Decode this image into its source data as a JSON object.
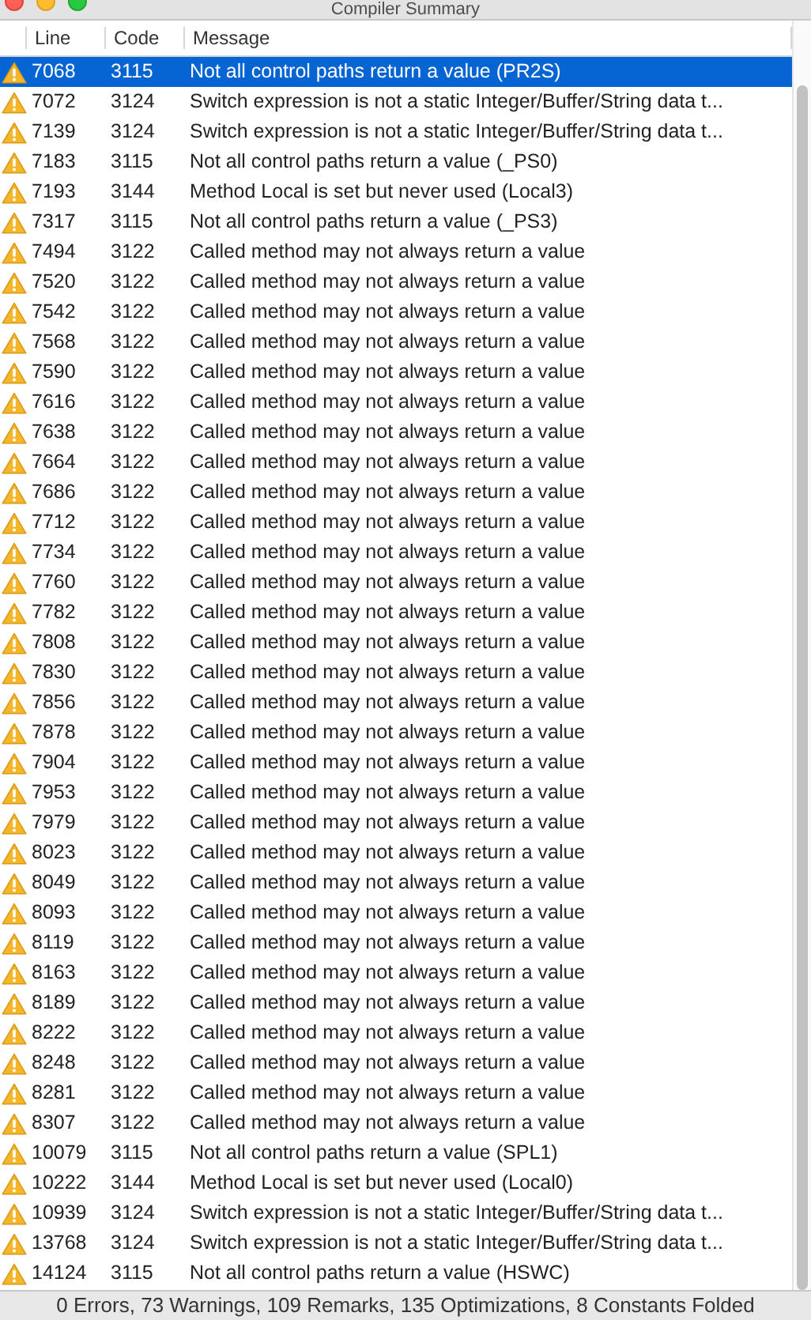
{
  "window": {
    "title": "Compiler Summary"
  },
  "table": {
    "columns": [
      "Line",
      "Code",
      "Message"
    ],
    "rows": [
      {
        "line": "7068",
        "code": "3115",
        "message": "Not all control paths return a value (PR2S)",
        "selected": true
      },
      {
        "line": "7072",
        "code": "3124",
        "message": "Switch expression is not a static Integer/Buffer/String data t...",
        "selected": false
      },
      {
        "line": "7139",
        "code": "3124",
        "message": "Switch expression is not a static Integer/Buffer/String data t...",
        "selected": false
      },
      {
        "line": "7183",
        "code": "3115",
        "message": "Not all control paths return a value (_PS0)",
        "selected": false
      },
      {
        "line": "7193",
        "code": "3144",
        "message": "Method Local is set but never used (Local3)",
        "selected": false
      },
      {
        "line": "7317",
        "code": "3115",
        "message": "Not all control paths return a value (_PS3)",
        "selected": false
      },
      {
        "line": "7494",
        "code": "3122",
        "message": "Called method may not always return a value",
        "selected": false
      },
      {
        "line": "7520",
        "code": "3122",
        "message": "Called method may not always return a value",
        "selected": false
      },
      {
        "line": "7542",
        "code": "3122",
        "message": "Called method may not always return a value",
        "selected": false
      },
      {
        "line": "7568",
        "code": "3122",
        "message": "Called method may not always return a value",
        "selected": false
      },
      {
        "line": "7590",
        "code": "3122",
        "message": "Called method may not always return a value",
        "selected": false
      },
      {
        "line": "7616",
        "code": "3122",
        "message": "Called method may not always return a value",
        "selected": false
      },
      {
        "line": "7638",
        "code": "3122",
        "message": "Called method may not always return a value",
        "selected": false
      },
      {
        "line": "7664",
        "code": "3122",
        "message": "Called method may not always return a value",
        "selected": false
      },
      {
        "line": "7686",
        "code": "3122",
        "message": "Called method may not always return a value",
        "selected": false
      },
      {
        "line": "7712",
        "code": "3122",
        "message": "Called method may not always return a value",
        "selected": false
      },
      {
        "line": "7734",
        "code": "3122",
        "message": "Called method may not always return a value",
        "selected": false
      },
      {
        "line": "7760",
        "code": "3122",
        "message": "Called method may not always return a value",
        "selected": false
      },
      {
        "line": "7782",
        "code": "3122",
        "message": "Called method may not always return a value",
        "selected": false
      },
      {
        "line": "7808",
        "code": "3122",
        "message": "Called method may not always return a value",
        "selected": false
      },
      {
        "line": "7830",
        "code": "3122",
        "message": "Called method may not always return a value",
        "selected": false
      },
      {
        "line": "7856",
        "code": "3122",
        "message": "Called method may not always return a value",
        "selected": false
      },
      {
        "line": "7878",
        "code": "3122",
        "message": "Called method may not always return a value",
        "selected": false
      },
      {
        "line": "7904",
        "code": "3122",
        "message": "Called method may not always return a value",
        "selected": false
      },
      {
        "line": "7953",
        "code": "3122",
        "message": "Called method may not always return a value",
        "selected": false
      },
      {
        "line": "7979",
        "code": "3122",
        "message": "Called method may not always return a value",
        "selected": false
      },
      {
        "line": "8023",
        "code": "3122",
        "message": "Called method may not always return a value",
        "selected": false
      },
      {
        "line": "8049",
        "code": "3122",
        "message": "Called method may not always return a value",
        "selected": false
      },
      {
        "line": "8093",
        "code": "3122",
        "message": "Called method may not always return a value",
        "selected": false
      },
      {
        "line": "8119",
        "code": "3122",
        "message": "Called method may not always return a value",
        "selected": false
      },
      {
        "line": "8163",
        "code": "3122",
        "message": "Called method may not always return a value",
        "selected": false
      },
      {
        "line": "8189",
        "code": "3122",
        "message": "Called method may not always return a value",
        "selected": false
      },
      {
        "line": "8222",
        "code": "3122",
        "message": "Called method may not always return a value",
        "selected": false
      },
      {
        "line": "8248",
        "code": "3122",
        "message": "Called method may not always return a value",
        "selected": false
      },
      {
        "line": "8281",
        "code": "3122",
        "message": "Called method may not always return a value",
        "selected": false
      },
      {
        "line": "8307",
        "code": "3122",
        "message": "Called method may not always return a value",
        "selected": false
      },
      {
        "line": "10079",
        "code": "3115",
        "message": "Not all control paths return a value (SPL1)",
        "selected": false
      },
      {
        "line": "10222",
        "code": "3144",
        "message": "Method Local is set but never used (Local0)",
        "selected": false
      },
      {
        "line": "10939",
        "code": "3124",
        "message": "Switch expression is not a static Integer/Buffer/String data t...",
        "selected": false
      },
      {
        "line": "13768",
        "code": "3124",
        "message": "Switch expression is not a static Integer/Buffer/String data t...",
        "selected": false
      },
      {
        "line": "14124",
        "code": "3115",
        "message": "Not all control paths return a value (HSWC)",
        "selected": false
      }
    ]
  },
  "status_bar": "0 Errors, 73 Warnings, 109 Remarks, 135 Optimizations, 8 Constants Folded"
}
